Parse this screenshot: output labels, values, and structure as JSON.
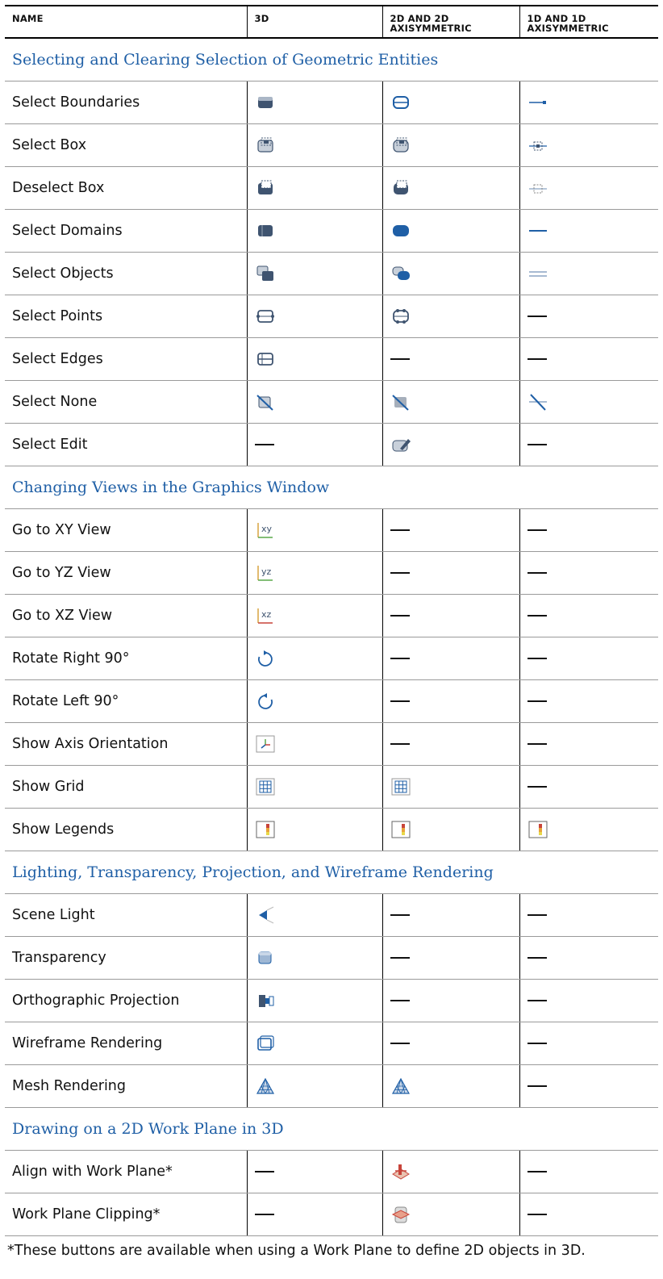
{
  "headers": [
    "NAME",
    "3D",
    "2D AND 2D AXISYMMETRIC",
    "1D AND 1D AXISYMMETRIC"
  ],
  "sections": [
    {
      "title": "Selecting and Clearing Selection of Geometric Entities",
      "rows": [
        {
          "name": "Select Boundaries",
          "c3d": "select-boundaries-3d-icon",
          "c2d": "select-boundaries-2d-icon",
          "c1d": "select-boundaries-1d-icon"
        },
        {
          "name": "Select Box",
          "c3d": "select-box-3d-icon",
          "c2d": "select-box-2d-icon",
          "c1d": "select-box-1d-icon"
        },
        {
          "name": "Deselect Box",
          "c3d": "deselect-box-3d-icon",
          "c2d": "deselect-box-2d-icon",
          "c1d": "deselect-box-1d-icon"
        },
        {
          "name": "Select Domains",
          "c3d": "select-domains-3d-icon",
          "c2d": "select-domains-2d-icon",
          "c1d": "select-domains-1d-icon"
        },
        {
          "name": "Select Objects",
          "c3d": "select-objects-3d-icon",
          "c2d": "select-objects-2d-icon",
          "c1d": "select-objects-1d-icon"
        },
        {
          "name": "Select Points",
          "c3d": "select-points-3d-icon",
          "c2d": "select-points-2d-icon",
          "c1d": "—"
        },
        {
          "name": "Select Edges",
          "c3d": "select-edges-3d-icon",
          "c2d": "—",
          "c1d": "—"
        },
        {
          "name": "Select None",
          "c3d": "select-none-3d-icon",
          "c2d": "select-none-2d-icon",
          "c1d": "select-none-1d-icon"
        },
        {
          "name": "Select Edit",
          "c3d": "—",
          "c2d": "select-edit-2d-icon",
          "c1d": "—"
        }
      ]
    },
    {
      "title": "Changing Views in the Graphics Window",
      "rows": [
        {
          "name": "Go to XY View",
          "c3d": "xy-view-icon",
          "c2d": "—",
          "c1d": "—"
        },
        {
          "name": "Go to YZ View",
          "c3d": "yz-view-icon",
          "c2d": "—",
          "c1d": "—"
        },
        {
          "name": "Go to XZ View",
          "c3d": "xz-view-icon",
          "c2d": "—",
          "c1d": "—"
        },
        {
          "name": "Rotate Right 90°",
          "c3d": "rotate-right-icon",
          "c2d": "—",
          "c1d": "—"
        },
        {
          "name": "Rotate Left 90°",
          "c3d": "rotate-left-icon",
          "c2d": "—",
          "c1d": "—"
        },
        {
          "name": "Show Axis Orientation",
          "c3d": "axis-orientation-icon",
          "c2d": "—",
          "c1d": "—"
        },
        {
          "name": "Show Grid",
          "c3d": "grid-icon",
          "c2d": "grid-icon",
          "c1d": "—"
        },
        {
          "name": "Show Legends",
          "c3d": "legend-icon",
          "c2d": "legend-icon",
          "c1d": "legend-icon"
        }
      ]
    },
    {
      "title": "Lighting, Transparency, Projection, and Wireframe Rendering",
      "rows": [
        {
          "name": "Scene Light",
          "c3d": "scene-light-icon",
          "c2d": "—",
          "c1d": "—"
        },
        {
          "name": "Transparency",
          "c3d": "transparency-icon",
          "c2d": "—",
          "c1d": "—"
        },
        {
          "name": "Orthographic Projection",
          "c3d": "orthographic-projection-icon",
          "c2d": "—",
          "c1d": "—"
        },
        {
          "name": "Wireframe Rendering",
          "c3d": "wireframe-icon",
          "c2d": "—",
          "c1d": "—"
        },
        {
          "name": "Mesh Rendering",
          "c3d": "mesh-icon",
          "c2d": "mesh-icon",
          "c1d": "—"
        }
      ]
    },
    {
      "title": "Drawing on a 2D Work Plane in 3D",
      "rows": [
        {
          "name": "Align with Work Plane*",
          "c3d": "—",
          "c2d": "align-work-plane-icon",
          "c1d": "—"
        },
        {
          "name": "Work Plane Clipping*",
          "c3d": "—",
          "c2d": "work-plane-clipping-icon",
          "c1d": "—"
        }
      ]
    }
  ],
  "footnote": "*These buttons are available when using a Work Plane to define 2D objects in 3D.",
  "colors": {
    "section_title": "#1f5fa6",
    "icon_dark": "#3f5470",
    "icon_blue": "#1f5fa6"
  }
}
